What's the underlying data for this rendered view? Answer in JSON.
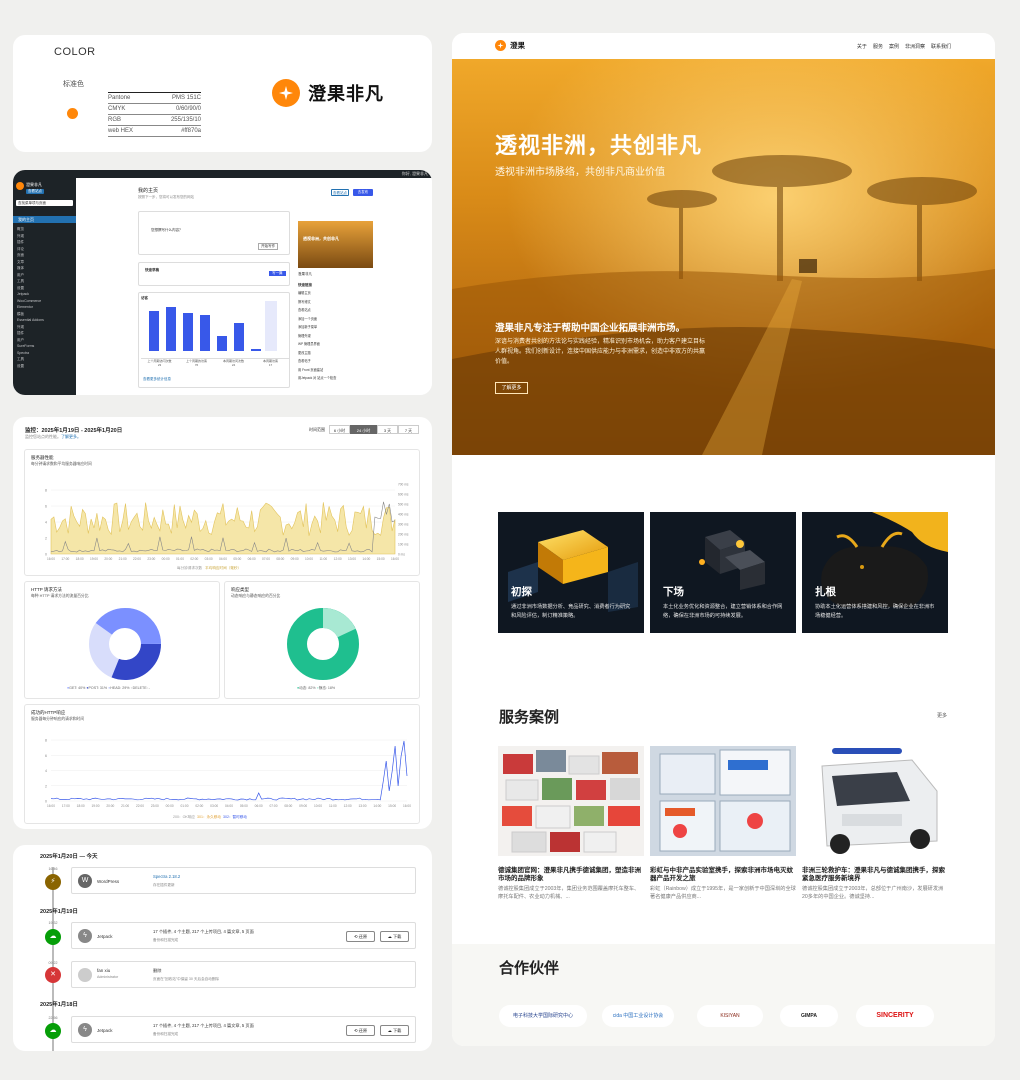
{
  "color_card": {
    "title": "COLOR",
    "label": "标准色",
    "rows": [
      {
        "k": "Pantone",
        "v": "PMS 151C"
      },
      {
        "k": "CMYK",
        "v": "0/60/90/0"
      },
      {
        "k": "RGB",
        "v": "255/135/10"
      },
      {
        "k": "web HEX",
        "v": "#ff870a"
      }
    ],
    "brand_name": "澄果非凡",
    "brand_color": "#ff870a"
  },
  "dashboard": {
    "topbar_right": "你好, 澄果非凡",
    "site_name": "澄果非凡",
    "site_tag": "查看站点",
    "search_placeholder": "查找菜单项与页面",
    "active_item": "我的主页",
    "menu": [
      "概览",
      "外观",
      "插件",
      "评论",
      "页面",
      "文章",
      "媒体",
      "用户",
      "工具",
      "设置",
      "Jetpack",
      "WooCommerce",
      "Elementor",
      "模板",
      "Essential Addons",
      "外观",
      "插件",
      "用户",
      "SureForms",
      "Spectra",
      "工具",
      "设置"
    ],
    "heading": "我的主页",
    "subheading": "按照下一步，您将可以发布您的网站",
    "btn_secondary": "查看站点",
    "btn_primary": "去发布",
    "prompt": "您想撰写什么内容？",
    "prompt_btn": "开始写作",
    "draft_title": "快速草稿",
    "draft_btn": "写一篇",
    "stats_title": "访客",
    "stats_note": "查看更多统计信息",
    "stat_cols": [
      "上个周期访问次数",
      "上个周期的访客",
      "本周期访问次数",
      "本周期访客"
    ],
    "stat_vals": [
      "23",
      "76",
      "24",
      "17"
    ],
    "preview_text": "透视非洲，共创非凡",
    "preview_site": "澄果非凡",
    "quick_title": "快速链接",
    "quick_links": [
      "编辑主页",
      "撰写博文",
      "查看站点",
      "添加一个页面",
      "添加新子菜单",
      "管理外观",
      "WP 管理员界面",
      "更改主题",
      "查看帖子",
      "用 Front 页面建站",
      "用Jetpack 对 站点一个检查"
    ]
  },
  "monitor": {
    "title": "监控：2025年1月19日 - 2025年1月20日",
    "subtitle": "监控您站点的性能。",
    "subtitle_link": "了解更多。",
    "range_label": "时间范围",
    "ranges": [
      "6 小时",
      "24 小时",
      "3 天",
      "7 天"
    ],
    "active_range": "24 小时",
    "perf_title": "服务器性能",
    "perf_sub": "每分钟请求数和平均服务器响应时间",
    "perf_legend": [
      "每分钟请求次数",
      "平均响应时间（毫秒）"
    ],
    "http_title": "HTTP 请求方法",
    "http_sub": "每种 HTTP 请求方法的流量百分比",
    "http_legend": [
      "GET: 40%",
      "POST: 31%",
      "HEAD: 29%",
      "DELETE: -"
    ],
    "resp_title": "响应类型",
    "resp_sub": "动态响应与静态响应的百分比",
    "resp_legend": [
      "动态: 82%",
      "静态: 18%"
    ],
    "status_title": "成功的HTTP响应",
    "status_sub": "服务器每分钟响应的请求和时间",
    "status_legend": [
      "200：OK响应",
      "301：永久移动",
      "302：暂时移动"
    ],
    "x_ticks": [
      "16:00",
      "17:00",
      "18:00",
      "19:00",
      "20:00",
      "21:00",
      "22:00",
      "23:00",
      "00:00",
      "01:00",
      "02:00",
      "03:00",
      "04:00",
      "05:00",
      "06:00",
      "07:00",
      "08:00",
      "09:00",
      "10:00",
      "11:00",
      "12:00",
      "13:00",
      "14:00",
      "15:00",
      "16:00"
    ],
    "y_ticks_left": [
      "8",
      "6",
      "4",
      "2",
      "0"
    ],
    "y_ticks_right": [
      "700 ms",
      "600 ms",
      "500 ms",
      "400 ms",
      "300 ms",
      "200 ms",
      "100 ms",
      "0 ms"
    ],
    "colors": {
      "blue": "#3858e9",
      "mid": "#7b90ff",
      "light": "#d8ddfb",
      "green": "#1fbf8f",
      "green_light": "#a8e9d3",
      "yellow": "#f5e6a8",
      "line_yellow": "#e2c35b"
    }
  },
  "timeline": {
    "days": [
      {
        "date": "2025年1月20日 — 今天"
      },
      {
        "date": "2025年1月19日"
      },
      {
        "date": "2025年1月18日"
      }
    ],
    "entries": [
      {
        "time": "16:46",
        "name": "WordPress",
        "sub": "",
        "desc": "Spectra 2.18.2",
        "desc2": "存在插件更新"
      },
      {
        "time": "19:32",
        "name": "Jetpack",
        "sub": "",
        "desc": "17 个插件, 4 个主题, 217 个上传项目, 4 篇文章, 5 页面",
        "desc2": "备份和扫描完成"
      },
      {
        "time": "09:22",
        "name": "fan xiu",
        "sub": "Administrator",
        "desc": "删除",
        "desc2": "页面在\"回收站\"中保留 30 天后会自动删除"
      },
      {
        "time": "22:56",
        "name": "Jetpack",
        "sub": "",
        "desc": "17 个插件, 4 个主题, 217 个上传项目, 4 篇文章, 5 页面",
        "desc2": "备份和扫描完成"
      }
    ],
    "restore_label": "还原",
    "download_label": "下载"
  },
  "website": {
    "brand": "澄果",
    "nav": [
      "关于",
      "服务",
      "案例",
      "非洲洞察",
      "联系我们"
    ],
    "hero_title": "透视非洲，共创非凡",
    "hero_subtitle": "透视非洲市场脉络，共创非凡商业价值",
    "hero_intro_title": "澄果非凡专注于帮助中国企业拓展非洲市场。",
    "hero_intro": "深谙与消费者共创的方法论与实践经验，精准识别市场机会，助力客户建立目标人群视角。我们创新设计，连接中国供应能力与非洲需求，创造中非双方的共赢价值。",
    "hero_button": "了解更多",
    "features": [
      {
        "title": "初探",
        "desc": "通过非洲市场数据分析、竞品研究、消费者行为研究和风险评估，制订精准策略。"
      },
      {
        "title": "下场",
        "desc": "本土化业务优化和资源整合，建立营销体系和合作网络，确保在非洲市场的可持续发展。"
      },
      {
        "title": "扎根",
        "desc": "协助本土化运营体系搭建和风控，确保企业在非洲市场稳健经营。"
      }
    ],
    "cases_title": "服务案例",
    "cases_more": "更多",
    "cases": [
      {
        "title": "德诚集团官网：澄果非凡携手德诚集团，塑造非洲市场的品牌形象",
        "desc": "德诚控股集团成立于2003年，集团业务范围覆盖摩托车整车、摩托车配件、农业动力机械、..."
      },
      {
        "title": "彩虹与中非产品实验室携手，探索非洲市场电灭蚊器产品开发之旅",
        "desc": "彩虹（Rainbow）成立于1995年，是一家创新于中国深圳的全球著名健康产品供应商..."
      },
      {
        "title": "非洲三轮救护车：澄果非凡与德诚集团携手，探索紧急医疗服务新境界",
        "desc": "德诚控股集团成立于2003年，总部位于广州南沙，发展研发洲20多年的中国企业。德诚坚持..."
      }
    ],
    "partners_title": "合作伙伴",
    "partners": [
      "电子科技大学国际研究中心",
      "cida 中国工业设计协会",
      "KISIYAN",
      "GIMPA",
      "SINCERITY"
    ]
  }
}
